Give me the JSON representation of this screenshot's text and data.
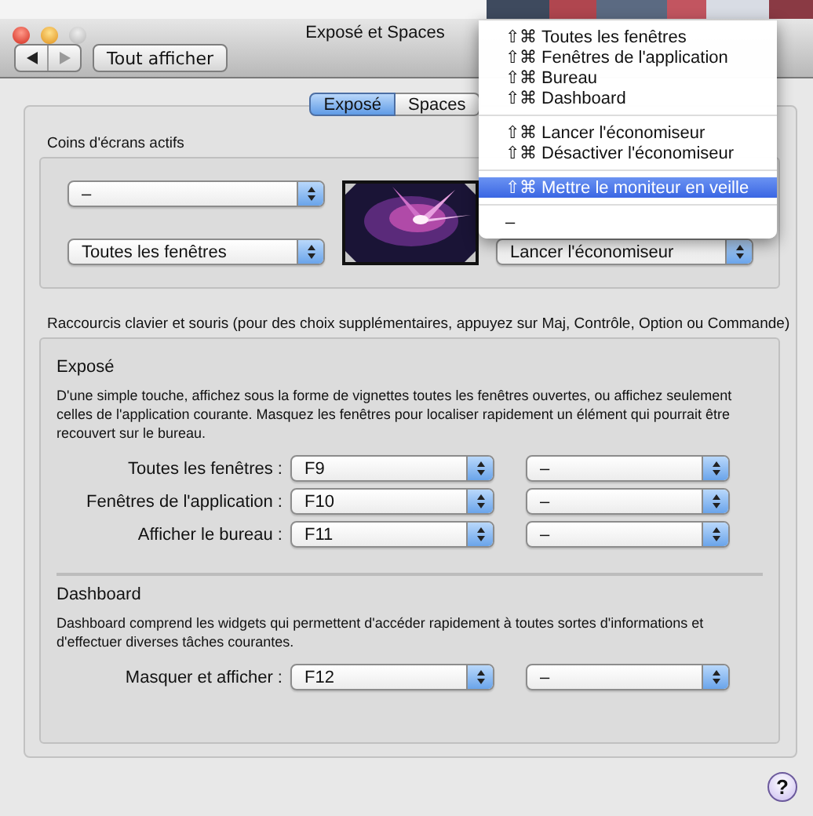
{
  "window": {
    "title": "Exposé et Spaces"
  },
  "toolbar": {
    "show_all_button": "Tout afficher"
  },
  "tabs": [
    {
      "label": "Exposé",
      "selected": true
    },
    {
      "label": "Spaces",
      "selected": false
    }
  ],
  "active_corners": {
    "title": "Coins d'écrans actifs",
    "top_left": "–",
    "bottom_left": "Toutes les fenêtres",
    "bottom_right": "Lancer l'économiseur"
  },
  "corner_menu": {
    "items": [
      {
        "kind": "item",
        "shortcut": "⇧⌘",
        "label": "Toutes les fenêtres",
        "selected": false
      },
      {
        "kind": "item",
        "shortcut": "⇧⌘",
        "label": "Fenêtres de l'application",
        "selected": false
      },
      {
        "kind": "item",
        "shortcut": "⇧⌘",
        "label": "Bureau",
        "selected": false
      },
      {
        "kind": "item",
        "shortcut": "⇧⌘",
        "label": "Dashboard",
        "selected": false
      },
      {
        "kind": "separator"
      },
      {
        "kind": "item",
        "shortcut": "⇧⌘",
        "label": "Lancer l'économiseur",
        "selected": false
      },
      {
        "kind": "item",
        "shortcut": "⇧⌘",
        "label": "Désactiver l'économiseur",
        "selected": false
      },
      {
        "kind": "separator"
      },
      {
        "kind": "item",
        "shortcut": "⇧⌘",
        "label": "Mettre le moniteur en veille",
        "selected": true
      },
      {
        "kind": "separator"
      },
      {
        "kind": "item",
        "label": "–",
        "selected": false
      }
    ]
  },
  "shortcuts": {
    "title": "Raccourcis clavier et souris (pour des choix supplémentaires, appuyez sur Maj, Contrôle, Option ou Commande)",
    "sections": [
      {
        "title": "Exposé",
        "description": "D'une simple touche, affichez sous la forme de vignettes toutes les fenêtres ouvertes, ou affichez seulement celles de l'application courante. Masquez les fenêtres pour localiser rapidement un élément qui pourrait être recouvert sur le bureau.",
        "rows": [
          {
            "label": "Toutes les fenêtres :",
            "key": "F9",
            "mouse": "–"
          },
          {
            "label": "Fenêtres de l'application :",
            "key": "F10",
            "mouse": "–"
          },
          {
            "label": "Afficher le bureau :",
            "key": "F11",
            "mouse": "–"
          }
        ]
      },
      {
        "title": "Dashboard",
        "description": "Dashboard comprend les widgets qui permettent d'accéder rapidement à toutes sortes d'informations et d'effectuer diverses tâches courantes.",
        "rows": [
          {
            "label": "Masquer et afficher :",
            "key": "F12",
            "mouse": "–"
          }
        ]
      }
    ]
  },
  "help_button": "?"
}
